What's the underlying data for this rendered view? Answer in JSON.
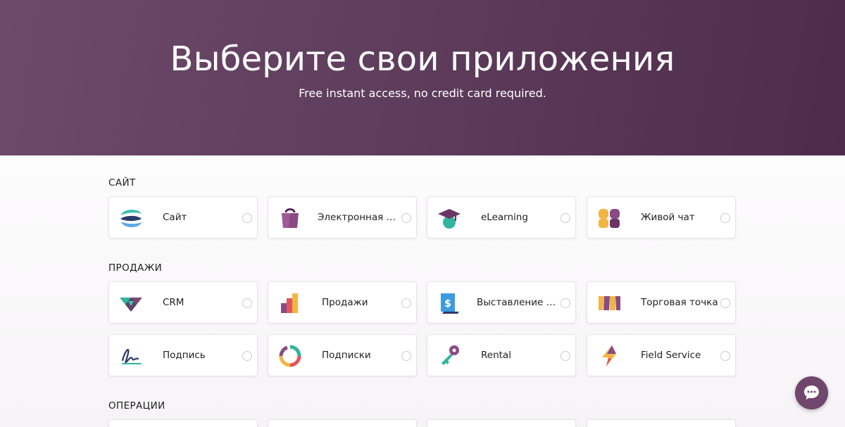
{
  "hero": {
    "title": "Выберите свои приложения",
    "subtitle": "Free instant access, no credit card required."
  },
  "sections": [
    {
      "title": "САЙТ",
      "apps": [
        {
          "label": "Сайт",
          "icon": "website-icon"
        },
        {
          "label": "Электронная коммерция",
          "icon": "ecommerce-bag-icon"
        },
        {
          "label": "eLearning",
          "icon": "graduation-cap-icon"
        },
        {
          "label": "Живой чат",
          "icon": "live-chat-icon"
        }
      ]
    },
    {
      "title": "ПРОДАЖИ",
      "apps": [
        {
          "label": "CRM",
          "icon": "crm-handshake-icon"
        },
        {
          "label": "Продажи",
          "icon": "sales-bars-icon"
        },
        {
          "label": "Выставление счетов",
          "icon": "invoicing-dollar-icon"
        },
        {
          "label": "Торговая точка",
          "icon": "pos-awning-icon"
        },
        {
          "label": "Подпись",
          "icon": "signature-icon"
        },
        {
          "label": "Подписки",
          "icon": "subscriptions-cycle-icon"
        },
        {
          "label": "Rental",
          "icon": "rental-key-icon"
        },
        {
          "label": "Field Service",
          "icon": "field-service-bolt-icon"
        }
      ]
    },
    {
      "title": "ОПЕРАЦИИ",
      "apps": []
    }
  ],
  "colors": {
    "hero_start": "#6e4a6a",
    "hero_end": "#4e2b4b",
    "accent": "#71466d"
  },
  "chat_button": {
    "icon": "chat-bubble-icon"
  }
}
